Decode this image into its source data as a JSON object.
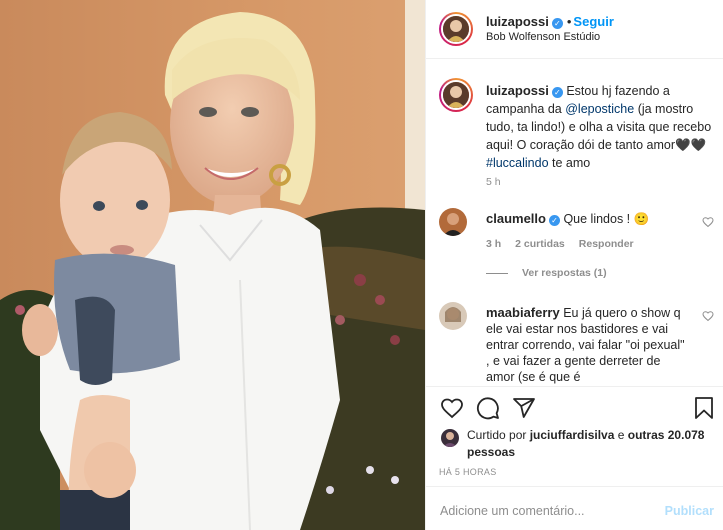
{
  "header": {
    "username": "luizapossi",
    "separator": "•",
    "follow_label": "Seguir",
    "location": "Bob Wolfenson Estúdio"
  },
  "caption": {
    "username": "luizapossi",
    "text_before": " Estou hj fazendo a campanha da ",
    "mention": "@lepostiche",
    "text_middle": " (ja mostro tudo, ta lindo!) e olha a visita que recebo aqui! O coração dói de tanto amor🖤🖤 ",
    "hashtag": "#luccalindo",
    "text_after": " te amo",
    "time": "5 h"
  },
  "comments": [
    {
      "username": "claumello",
      "text": " Que lindos ! 🙂",
      "time": "3 h",
      "likes": "2 curtidas",
      "reply_label": "Responder",
      "view_replies": "Ver respostas (1)"
    },
    {
      "username": "maabiaferry",
      "text": " Eu já quero o show q ele vai estar nos bastidores e vai entrar correndo, vai falar \"oi pexual\" , e vai fazer a gente derreter de amor (se é que é"
    }
  ],
  "likes": {
    "prefix": "Curtido por ",
    "user": "juciuffardisilva",
    "middle": " e ",
    "others": "outras 20.078 pessoas"
  },
  "time_ago": "HÁ 5 HORAS",
  "comment_box": {
    "placeholder": "Adicione um comentário...",
    "publish_label": "Publicar"
  },
  "colors": {
    "link_blue": "#0095f6",
    "verified_blue": "#3897f0",
    "muted": "#8e8e8e",
    "publish_disabled": "#b2dffc"
  },
  "icons": [
    "verified-badge-icon",
    "heart-icon",
    "comment-icon",
    "share-icon",
    "bookmark-icon",
    "small-heart-icon"
  ]
}
